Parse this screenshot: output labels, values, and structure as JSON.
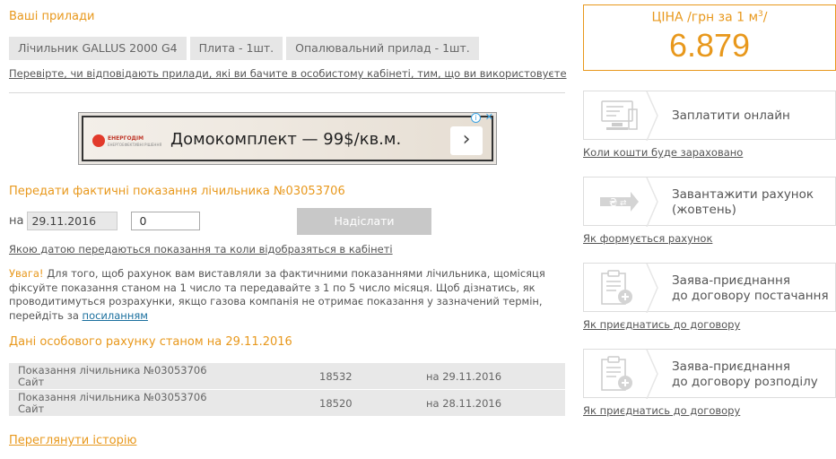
{
  "devices_section": {
    "title": "Ваші прилади",
    "items": [
      "Лічильник GALLUS 2000 G4",
      "Плита - 1шт.",
      "Опалювальний прилад - 1шт."
    ],
    "check_link": "Перевірте, чи відповідають прилади, які ви бачите в особистому кабінеті, тим, що ви використовуєте"
  },
  "ad": {
    "brand": "ЕНЕРГОДІМ",
    "brand_sub": "ЕНЕРГОЕФЕКТИВНІ РІШЕННЯ",
    "text": "Домокомплект — 99$/кв.м.",
    "arrow": "›",
    "info": "i",
    "close": "✕"
  },
  "submit": {
    "title": "Передати фактичні показання лічильника №03053706",
    "date_prefix": "на",
    "date_value": "29.11.2016",
    "reading_value": "0",
    "button": "Надіслати",
    "date_link": "Якою датою передаються показання та коли відобразяться в кабінеті"
  },
  "notice": {
    "warn": "Увага!",
    "text": " Для того, щоб рахунок вам виставляли за фактичними показаннями лічильника, щомісяця фіксуйте показання станом на 1 число та передавайте з 1 по 5 число місяця. Щоб дізнатись, як проводитимуться розрахунки, якщо газова компанія не отримає показання у зазначений термін, перейдіть за ",
    "link": "посиланням"
  },
  "account": {
    "title": "Дані особового рахунку станом на 29.11.2016",
    "rows": [
      {
        "label1": "Показання лічильника №03053706",
        "label2": "Сайт",
        "value": "18532",
        "date": "на 29.11.2016"
      },
      {
        "label1": "Показання лічильника №03053706",
        "label2": "Сайт",
        "value": "18520",
        "date": "на 28.11.2016"
      }
    ],
    "history_link": "Переглянути історію"
  },
  "price": {
    "label": "ЦІНА /грн за 1 м",
    "label_sup": "3",
    "label_end": "/",
    "value": "6.879"
  },
  "actions": [
    {
      "title_line1": "Заплатити онлайн",
      "title_line2": "",
      "link": "Коли кошти буде зараховано",
      "icon": "computer-icon"
    },
    {
      "title_line1": "Завантажити рахунок",
      "title_line2": "(жовтень)",
      "link": "Як формується рахунок",
      "icon": "hryvnia-exchange-icon"
    },
    {
      "title_line1": "Заява-приєднання",
      "title_line2": "до договору постачання",
      "link": "Як приєднатись до договору",
      "icon": "clipboard-add-icon"
    },
    {
      "title_line1": "Заява-приєднання",
      "title_line2": "до договору розподілу",
      "link": "Як приєднатись до договору",
      "icon": "clipboard-add-icon"
    }
  ],
  "colors": {
    "accent": "#e8981c",
    "panel": "#e8e8e8",
    "button_disabled": "#c8c8c8",
    "link_blue": "#1a6f9e"
  }
}
